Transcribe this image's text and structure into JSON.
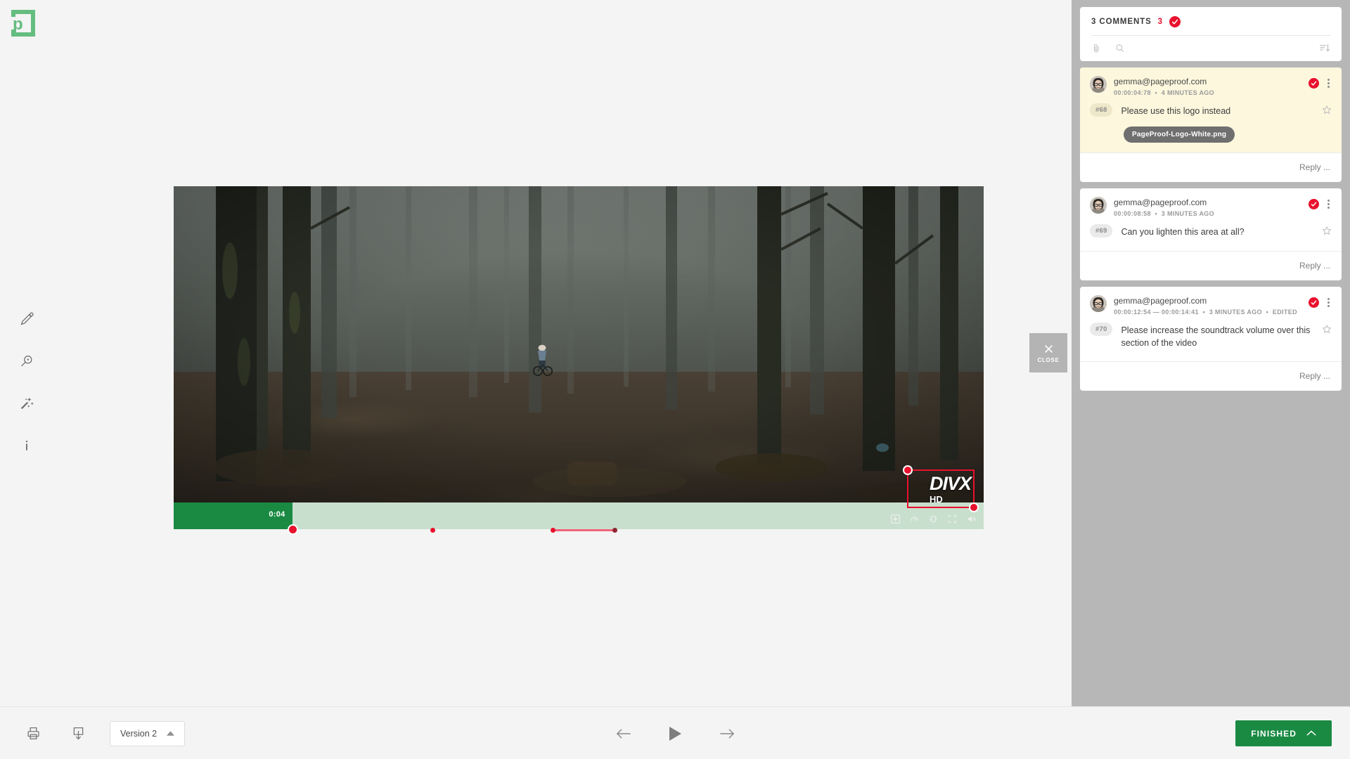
{
  "app": {
    "logo_name": "pageproof-logo",
    "brand_color": "#65bd7f",
    "accent_red": "#e8112d",
    "accent_green": "#1a8a43"
  },
  "toolbar": {
    "items": [
      {
        "name": "annotate-pen-tool",
        "label": "Annotate"
      },
      {
        "name": "zoom-tool",
        "label": "Zoom"
      },
      {
        "name": "magic-wand-tool",
        "label": "Magic wand"
      },
      {
        "name": "info-tool",
        "label": "Info"
      }
    ]
  },
  "player": {
    "current_time_label": "0:04",
    "progress_percent": 14.7,
    "watermark_line1": "DIVX",
    "watermark_line2": "HD",
    "markers": [
      {
        "id": "#68",
        "position_percent": 14.7,
        "type": "point"
      },
      {
        "id": "#69",
        "position_percent": 32.0,
        "type": "point"
      },
      {
        "id": "#70",
        "position_percent": 46.8,
        "type": "range",
        "end_percent": 54.5
      }
    ],
    "controls": [
      {
        "name": "settings-icon",
        "label": "Settings"
      },
      {
        "name": "speed-icon",
        "label": "Playback speed"
      },
      {
        "name": "loop-icon",
        "label": "Loop"
      },
      {
        "name": "fullscreen-icon",
        "label": "Fullscreen"
      },
      {
        "name": "volume-icon",
        "label": "Volume"
      }
    ]
  },
  "close_panel": {
    "label": "CLOSE"
  },
  "comments_panel": {
    "header": {
      "title": "3 COMMENTS",
      "count": "3"
    },
    "tools": {
      "attach": "attachment-icon",
      "search": "search-icon",
      "sort": "sort-descending-icon"
    },
    "reply_label": "Reply ...",
    "items": [
      {
        "author": "gemma@pageproof.com",
        "timecode": "00:00:04:78",
        "age": "4 MINUTES AGO",
        "meta_sep": "•",
        "edited": "",
        "number": "#68",
        "text": "Please use this logo instead",
        "attachment": "PageProof-Logo-White.png",
        "highlighted": true
      },
      {
        "author": "gemma@pageproof.com",
        "timecode": "00:00:08:58",
        "age": "3 MINUTES AGO",
        "meta_sep": "•",
        "edited": "",
        "number": "#69",
        "text": "Can you lighten this area at all?",
        "attachment": "",
        "highlighted": false
      },
      {
        "author": "gemma@pageproof.com",
        "timecode": "00:00:12:54 — 00:00:14:41",
        "age": "3 MINUTES AGO",
        "meta_sep": "•",
        "edited": "EDITED",
        "number": "#70",
        "text": "Please increase the soundtrack volume over this section of the video",
        "attachment": "",
        "highlighted": false
      }
    ]
  },
  "bottom_bar": {
    "print_label": "Print",
    "download_label": "Download",
    "version_label": "Version 2",
    "prev_label": "Previous",
    "play_label": "Play",
    "next_label": "Next",
    "finished_label": "FINISHED"
  }
}
